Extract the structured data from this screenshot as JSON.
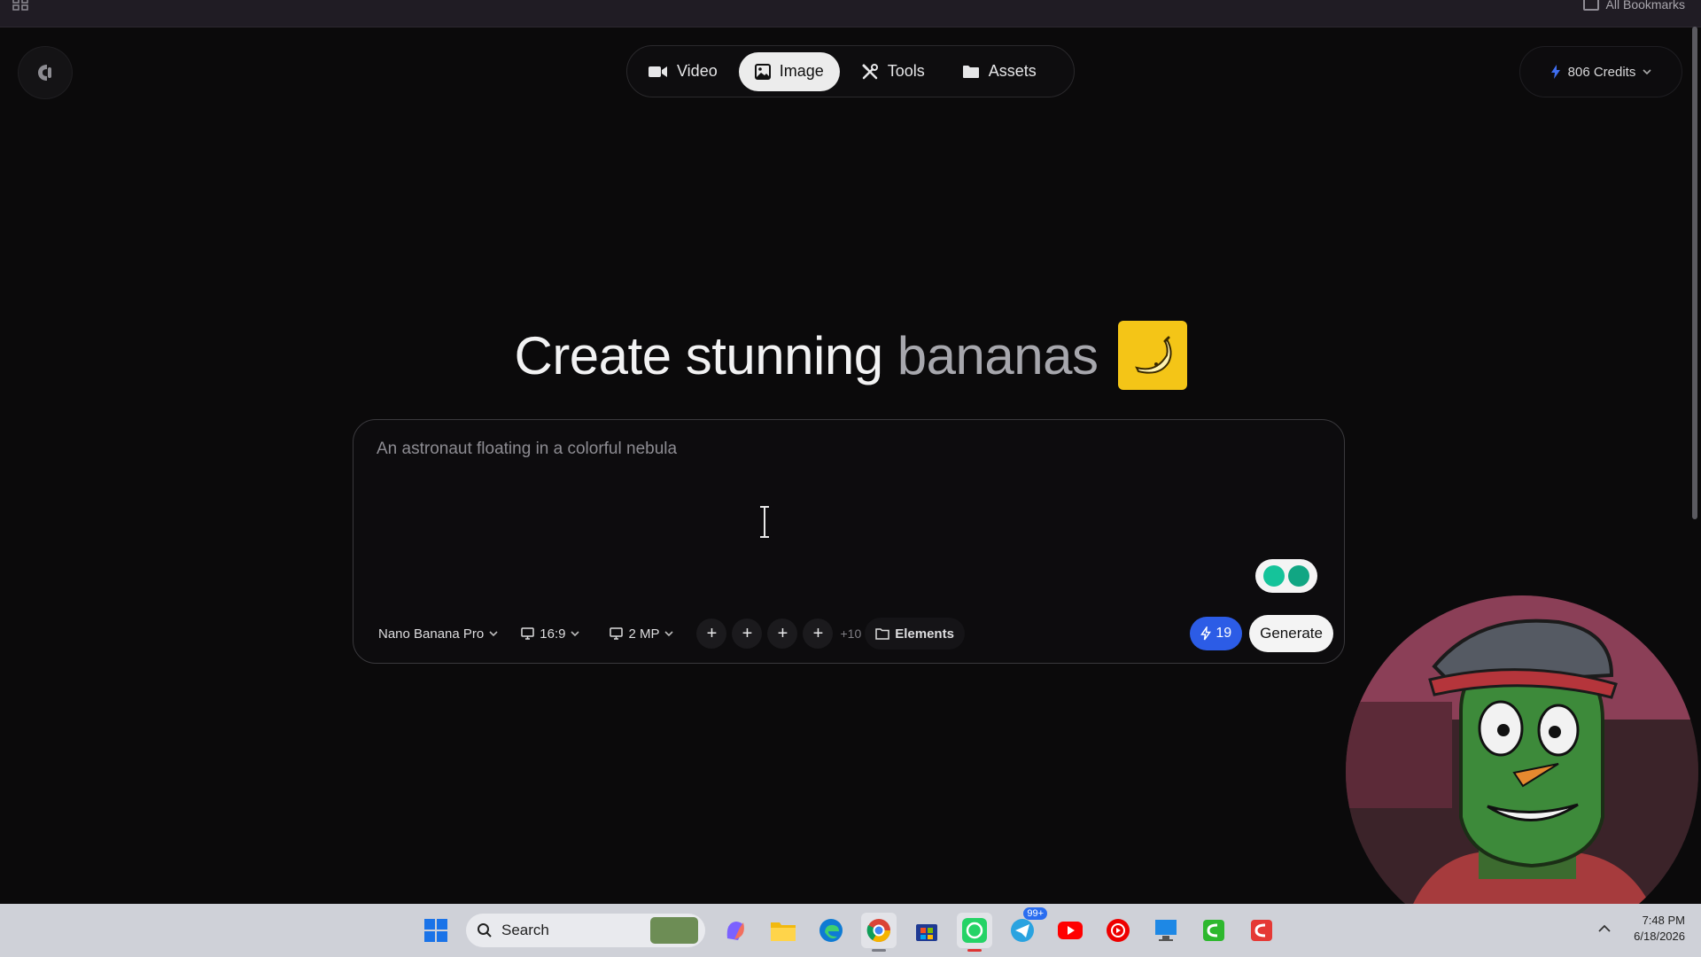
{
  "browser": {
    "all_bookmarks": "All Bookmarks"
  },
  "nav": {
    "tabs": [
      {
        "label": "Video",
        "icon": "video-camera-icon"
      },
      {
        "label": "Image",
        "icon": "image-icon",
        "active": true
      },
      {
        "label": "Tools",
        "icon": "tools-icon"
      },
      {
        "label": "Assets",
        "icon": "folder-icon"
      }
    ]
  },
  "credits": {
    "label": "806 Credits",
    "icon": "bolt-icon"
  },
  "hero": {
    "title_main": "Create stunning",
    "title_accent": "bananas",
    "emoji": "🍌"
  },
  "prompt": {
    "placeholder": "An astronaut floating in a colorful nebula",
    "value": ""
  },
  "toolbar": {
    "model": "Nano Banana Pro",
    "aspect_ratio": "16:9",
    "resolution": "2 MP",
    "add_slots": [
      "+",
      "+",
      "+",
      "+"
    ],
    "more_count": "+10",
    "elements_label": "Elements",
    "cost": "19",
    "generate_label": "Generate"
  },
  "taskbar": {
    "search_label": "Search",
    "badge": "99+",
    "time": "7:48 PM",
    "date": "6/18/2026"
  },
  "colors": {
    "background": "#0b0a0b",
    "accent_blue": "#2c5ce6",
    "banana_yellow": "#f4c517"
  }
}
